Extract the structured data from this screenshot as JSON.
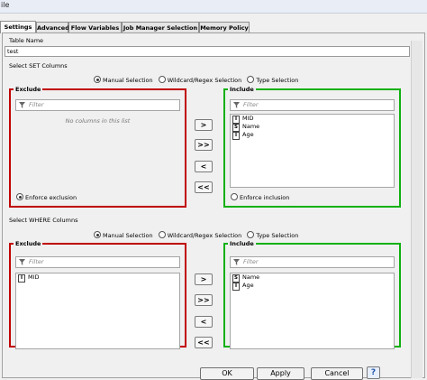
{
  "window": {
    "title": "ile"
  },
  "tabs": [
    {
      "label": "Settings",
      "active": true
    },
    {
      "label": "Advanced",
      "active": false
    },
    {
      "label": "Flow Variables",
      "active": false
    },
    {
      "label": "Job Manager Selection",
      "active": false
    },
    {
      "label": "Memory Policy",
      "active": false
    }
  ],
  "table_name": {
    "label": "Table Name",
    "value": "test"
  },
  "set_section": {
    "label": "Select SET Columns",
    "modes": [
      "Manual Selection",
      "Wildcard/Regex Selection",
      "Type Selection"
    ],
    "selected_mode": "Manual Selection",
    "exclude": {
      "title": "Exclude",
      "filter_placeholder": "Filter",
      "empty_message": "No columns in this list",
      "items": [],
      "enforce_label": "Enforce exclusion",
      "enforce_selected": true
    },
    "include": {
      "title": "Include",
      "filter_placeholder": "Filter",
      "items": [
        {
          "type": "I",
          "name": "MID"
        },
        {
          "type": "S",
          "name": "Name"
        },
        {
          "type": "I",
          "name": "Age"
        }
      ],
      "enforce_label": "Enforce inclusion",
      "enforce_selected": false
    },
    "buttons": [
      ">",
      ">>",
      "<",
      "<<"
    ]
  },
  "where_section": {
    "label": "Select WHERE Columns",
    "modes": [
      "Manual Selection",
      "Wildcard/Regex Selection",
      "Type Selection"
    ],
    "selected_mode": "Manual Selection",
    "exclude": {
      "title": "Exclude",
      "filter_placeholder": "Filter",
      "items": [
        {
          "type": "I",
          "name": "MID"
        }
      ]
    },
    "include": {
      "title": "Include",
      "filter_placeholder": "Filter",
      "items": [
        {
          "type": "S",
          "name": "Name"
        },
        {
          "type": "I",
          "name": "Age"
        }
      ]
    },
    "buttons": [
      ">",
      ">>",
      "<",
      "<<"
    ]
  },
  "footer": {
    "ok": "OK",
    "apply": "Apply",
    "cancel": "Cancel",
    "help": "?"
  },
  "colors": {
    "exclude_border": "#c00000",
    "include_border": "#10b010"
  },
  "icons": {
    "filter": "funnel-icon",
    "help": "help-icon"
  }
}
